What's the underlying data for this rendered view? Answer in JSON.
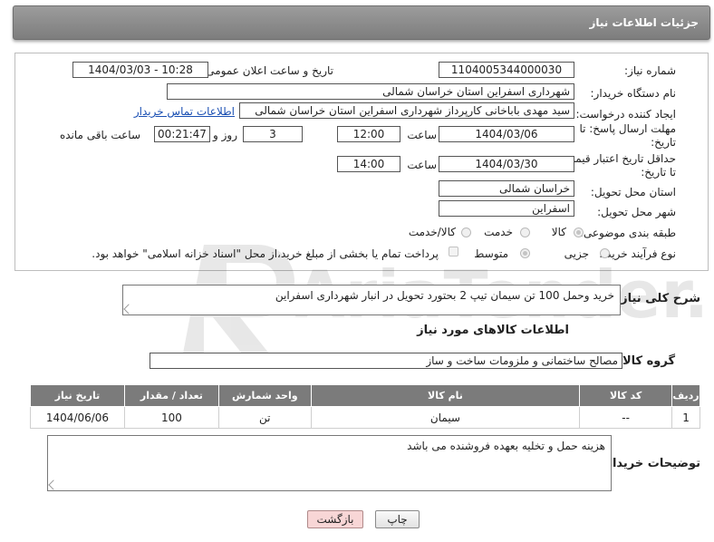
{
  "header": {
    "title": "جزئیات اطلاعات نیاز"
  },
  "form": {
    "need_number_label": "شماره نیاز:",
    "need_number": "1104005344000030",
    "announce_label": "تاریخ و ساعت اعلان عمومی:",
    "announce_value": "1404/03/03 - 10:28",
    "buyer_org_label": "نام دستگاه خریدار:",
    "buyer_org": "شهرداری اسفراین استان خراسان شمالی",
    "requester_label": "ایجاد کننده درخواست:",
    "requester": "سید مهدی  باباخانی کارپرداز   شهرداری اسفراین استان خراسان شمالی",
    "contact_link": "اطلاعات تماس خریدار",
    "deadline_label_1": "مهلت ارسال پاسخ: تا",
    "deadline_label_2": "تاریخ:",
    "deadline_date": "1404/03/06",
    "time_label": "ساعت",
    "deadline_time": "12:00",
    "days_value": "3",
    "days_label": "روز و",
    "remaining_time": "00:21:47",
    "remaining_label": "ساعت باقی مانده",
    "price_valid_label_1": "حداقل تاریخ اعتبار قیمت:",
    "price_valid_label_2": "تا تاریخ:",
    "price_valid_date": "1404/03/30",
    "price_valid_time": "14:00",
    "province_label": "استان محل تحویل:",
    "province": "خراسان شمالی",
    "city_label": "شهر محل تحویل:",
    "city": "اسفراین",
    "category_label": "طبقه بندی موضوعی:",
    "cat_goods": "کالا",
    "cat_service": "خدمت",
    "cat_goods_service": "کالا/خدمت",
    "process_label": "نوع فرآیند خرید :",
    "proc_minor": "جزیی",
    "proc_medium": "متوسط",
    "payment_note": "پرداخت تمام یا بخشی از مبلغ خرید،از محل \"اسناد خزانه اسلامی\" خواهد بود."
  },
  "description": {
    "label": "شرح کلی نیاز:",
    "text": "خرید وحمل 100 تن سیمان تیپ 2 بحتورد تحویل در انبار شهرداری اسفراین"
  },
  "goods_section": {
    "title": "اطلاعات کالاهای مورد نیاز",
    "group_label": "گروه کالا:",
    "group_value": "مصالح ساختمانی و ملزومات ساخت و ساز"
  },
  "table": {
    "headers": [
      "ردیف",
      "کد کالا",
      "نام کالا",
      "واحد شمارش",
      "تعداد / مقدار",
      "تاریخ نیاز"
    ],
    "rows": [
      [
        "1",
        "--",
        "سیمان",
        "تن",
        "100",
        "1404/06/06"
      ]
    ]
  },
  "buyer_notes": {
    "label": "توضیحات خریدار:",
    "text": "هزینه حمل و تخلیه بعهده فروشنده می باشد"
  },
  "buttons": {
    "print": "چاپ",
    "back": "بازگشت"
  },
  "watermark": {
    "text": "AriaTender.net"
  }
}
